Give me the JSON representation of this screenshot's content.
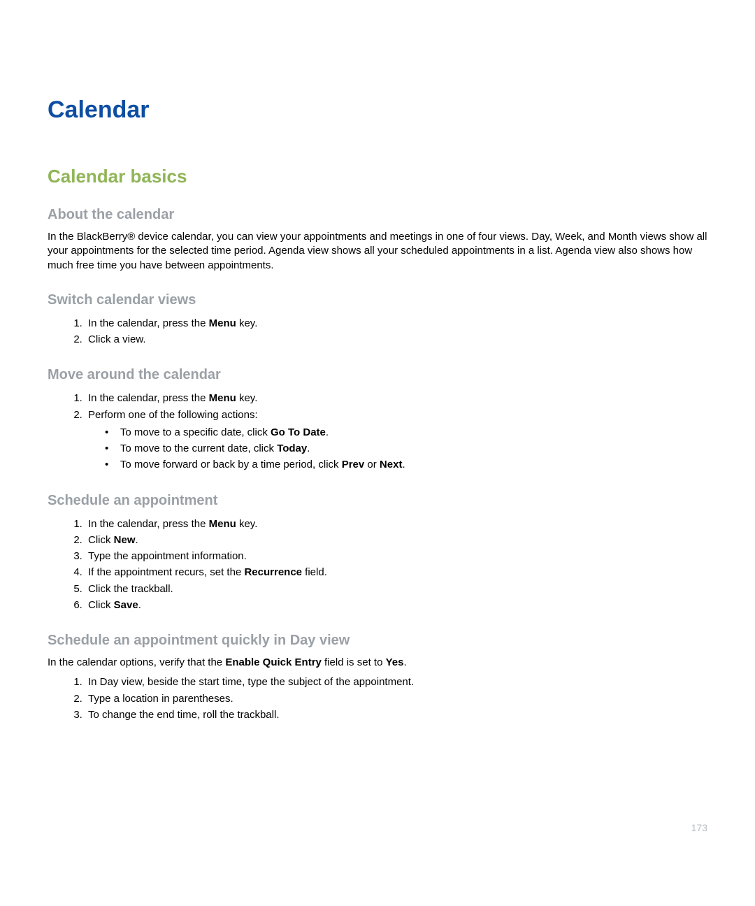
{
  "page_number": "173",
  "chapter": {
    "title": "Calendar"
  },
  "section": {
    "title": "Calendar basics"
  },
  "blocks": {
    "about": {
      "title": "About the calendar",
      "body": "In the BlackBerry® device calendar, you can view your appointments and meetings in one of four views. Day, Week, and Month views show all your appointments for the selected time period. Agenda view shows all your scheduled appointments in a list. Agenda view also shows how much free time you have between appointments."
    },
    "switch_views": {
      "title": "Switch calendar views",
      "step1_pre": "In the calendar, press the ",
      "step1_bold": "Menu",
      "step1_post": " key.",
      "step2": "Click a view."
    },
    "move_around": {
      "title": "Move around the calendar",
      "step1_pre": "In the calendar, press the ",
      "step1_bold": "Menu",
      "step1_post": " key.",
      "step2": "Perform one of the following actions:",
      "bullet1_pre": "To move to a specific date, click ",
      "bullet1_bold": "Go To Date",
      "bullet1_post": ".",
      "bullet2_pre": "To move to the current date, click ",
      "bullet2_bold": "Today",
      "bullet2_post": ".",
      "bullet3_pre": "To move forward or back by a time period, click ",
      "bullet3_bold1": "Prev",
      "bullet3_mid": " or ",
      "bullet3_bold2": "Next",
      "bullet3_post": "."
    },
    "schedule_appt": {
      "title": "Schedule an appointment",
      "step1_pre": "In the calendar, press the ",
      "step1_bold": "Menu",
      "step1_post": " key.",
      "step2_pre": "Click ",
      "step2_bold": "New",
      "step2_post": ".",
      "step3": "Type the appointment information.",
      "step4_pre": "If the appointment recurs, set the ",
      "step4_bold": "Recurrence",
      "step4_post": " field.",
      "step5": "Click the trackball.",
      "step6_pre": "Click ",
      "step6_bold": "Save",
      "step6_post": "."
    },
    "schedule_quick": {
      "title": "Schedule an appointment quickly in Day view",
      "intro_pre": "In the calendar options, verify that the ",
      "intro_bold1": "Enable Quick Entry",
      "intro_mid": " field is set to ",
      "intro_bold2": "Yes",
      "intro_post": ".",
      "step1": "In Day view, beside the start time, type the subject of the appointment.",
      "step2": "Type a location in parentheses.",
      "step3": "To change the end time, roll the trackball."
    }
  }
}
